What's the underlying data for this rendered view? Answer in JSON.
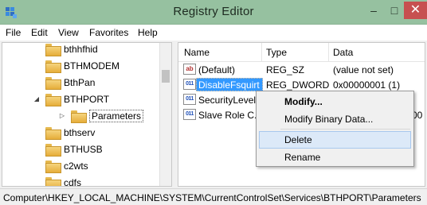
{
  "window": {
    "title": "Registry Editor",
    "controls": {
      "minimize": "–",
      "maximize": "□",
      "close": "✕"
    },
    "title_bar_color": "#96c1a0",
    "close_button_color": "#c75050"
  },
  "menubar": {
    "items": [
      "File",
      "Edit",
      "View",
      "Favorites",
      "Help"
    ]
  },
  "tree": {
    "items": [
      {
        "label": "bthhfhid",
        "expander": ""
      },
      {
        "label": "BTHMODEM",
        "expander": ""
      },
      {
        "label": "BthPan",
        "expander": ""
      },
      {
        "label": "BTHPORT",
        "expander": "◢"
      },
      {
        "label": "Parameters",
        "expander": "▷",
        "selected": true
      },
      {
        "label": "bthserv",
        "expander": ""
      },
      {
        "label": "BTHUSB",
        "expander": ""
      },
      {
        "label": "c2wts",
        "expander": ""
      },
      {
        "label": "cdfs",
        "expander": ""
      }
    ]
  },
  "values_list": {
    "columns": [
      "Name",
      "Type",
      "Data"
    ],
    "rows": [
      {
        "icon": "string-value-icon",
        "name": "(Default)",
        "type": "REG_SZ",
        "data": "(value not set)"
      },
      {
        "icon": "binary-value-icon",
        "name": "DisableFsquirt",
        "type": "REG_DWORD",
        "data": "0x00000001 (1)",
        "selected": true
      },
      {
        "icon": "binary-value-icon",
        "name": "SecurityLevel",
        "type": "",
        "data": ""
      },
      {
        "icon": "binary-value-icon",
        "name": "Slave Role C...",
        "type": "",
        "data": "00"
      }
    ],
    "selection_color": "#3399ff"
  },
  "context_menu": {
    "items": [
      {
        "label": "Modify...",
        "bold": true
      },
      {
        "label": "Modify Binary Data..."
      },
      {
        "label": "Delete",
        "highlighted": true
      },
      {
        "label": "Rename"
      }
    ]
  },
  "statusbar": {
    "path": "Computer\\HKEY_LOCAL_MACHINE\\SYSTEM\\CurrentControlSet\\Services\\BTHPORT\\Parameters"
  }
}
